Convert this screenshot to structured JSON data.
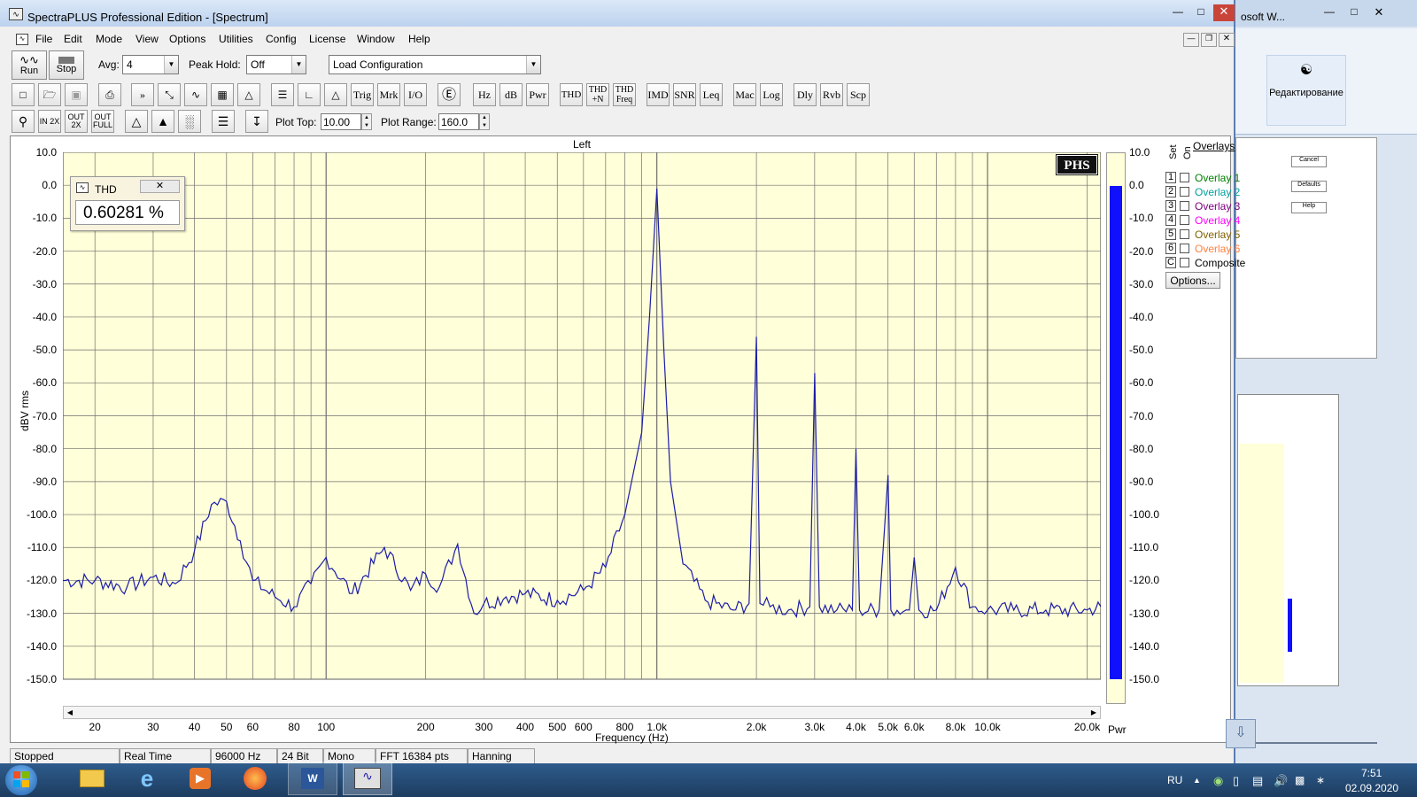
{
  "window": {
    "title": "SpectraPLUS Professional Edition - [Spectrum]"
  },
  "menu": [
    "File",
    "Edit",
    "Mode",
    "View",
    "Options",
    "Utilities",
    "Config",
    "License",
    "Window",
    "Help"
  ],
  "controls": {
    "run_label": "Run",
    "stop_label": "Stop",
    "avg_label": "Avg:",
    "avg_value": "4",
    "peak_hold_label": "Peak Hold:",
    "peak_hold_value": "Off",
    "load_config": "Load Configuration",
    "plot_top_label": "Plot Top:",
    "plot_top_value": "10.00",
    "plot_range_label": "Plot Range:",
    "plot_range_value": "160.0"
  },
  "toolbar": {
    "trig": "Trig",
    "mrk": "Mrk",
    "io": "I/O",
    "hz": "Hz",
    "db": "dB",
    "pwr": "Pwr",
    "thd": "THD",
    "thdn": "THD +N",
    "thdfreq": "THD Freq",
    "imd": "IMD",
    "snr": "SNR",
    "leq": "Leq",
    "mac": "Mac",
    "log": "Log",
    "dly": "Dly",
    "rvb": "Rvb",
    "scp": "Scp",
    "zoom_in": "IN 2X",
    "zoom_out": "OUT 2X",
    "zoom_full": "OUT FULL"
  },
  "thd_window": {
    "title": "THD",
    "value": "0.60281 %"
  },
  "plot": {
    "channel_title": "Left",
    "phs_logo": "PHS",
    "y_axis_label": "dBV rms",
    "x_axis_label": "Frequency (Hz)",
    "power_bar_label": "Pwr",
    "y_ticks": [
      "10.0",
      "0.0",
      "-10.0",
      "-20.0",
      "-30.0",
      "-40.0",
      "-50.0",
      "-60.0",
      "-70.0",
      "-80.0",
      "-90.0",
      "-100.0",
      "-110.0",
      "-120.0",
      "-130.0",
      "-140.0",
      "-150.0"
    ],
    "x_ticks": [
      "20",
      "30",
      "40",
      "50",
      "60",
      "80",
      "100",
      "200",
      "300",
      "400",
      "500",
      "600",
      "800",
      "1.0k",
      "2.0k",
      "3.0k",
      "4.0k",
      "5.0k",
      "6.0k",
      "8.0k",
      "10.0k",
      "20.0k"
    ],
    "power_level_db": -0.2,
    "colors": {
      "background": "#ffffd9",
      "trace": "#1c1ca8",
      "grid": "#6f6f6f",
      "power_bar": "#1010ff"
    }
  },
  "chart_data": {
    "type": "line",
    "title": "Left",
    "xlabel": "Frequency (Hz)",
    "ylabel": "dBV rms",
    "x_scale": "log",
    "xlim": [
      16,
      22000
    ],
    "ylim": [
      -150,
      10
    ],
    "grid": true,
    "series": [
      {
        "x": [
          16,
          20,
          25,
          30,
          35,
          40,
          45,
          50,
          55,
          60,
          70,
          80,
          90,
          100,
          120,
          150,
          180,
          200,
          220,
          250,
          280,
          300,
          350,
          400,
          500,
          600,
          700,
          800,
          900,
          950,
          1000,
          1050,
          1100,
          1200,
          1400,
          1700,
          1900,
          2000,
          2050,
          2200,
          2500,
          2900,
          3000,
          3100,
          3500,
          3900,
          4000,
          4100,
          4700,
          5000,
          5100,
          5800,
          6000,
          6200,
          7000,
          8000,
          9000,
          10000,
          12000,
          15000,
          20000,
          22000
        ],
        "y": [
          -120,
          -120,
          -122,
          -119,
          -121,
          -111,
          -97,
          -96,
          -108,
          -120,
          -125,
          -128,
          -121,
          -113,
          -124,
          -110,
          -123,
          -118,
          -122,
          -109,
          -130,
          -127,
          -125,
          -124,
          -126,
          -123,
          -116,
          -100,
          -75,
          -40,
          -1,
          -50,
          -90,
          -115,
          -126,
          -129,
          -127,
          -46,
          -127,
          -128,
          -129,
          -128,
          -57,
          -128,
          -129,
          -129,
          -80,
          -129,
          -129,
          -88,
          -129,
          -129,
          -113,
          -129,
          -129,
          -116,
          -128,
          -129,
          -129,
          -129,
          -129,
          -128
        ]
      }
    ]
  },
  "overlays": {
    "header": "Overlays",
    "set_label": "Set",
    "on_label": "On",
    "items": [
      {
        "num": "1",
        "label": "Overlay 1",
        "color": "#008000"
      },
      {
        "num": "2",
        "label": "Overlay 2",
        "color": "#00a0a0"
      },
      {
        "num": "3",
        "label": "Overlay 3",
        "color": "#800080"
      },
      {
        "num": "4",
        "label": "Overlay 4",
        "color": "#ff00ff"
      },
      {
        "num": "5",
        "label": "Overlay 5",
        "color": "#806000"
      },
      {
        "num": "6",
        "label": "Overlay 6",
        "color": "#ff8040"
      },
      {
        "num": "C",
        "label": "Composite",
        "color": "#000000"
      }
    ],
    "options_label": "Options..."
  },
  "status": [
    "Stopped",
    "Real Time",
    "96000 Hz",
    "24 Bit",
    "Mono",
    "FFT 16384 pts",
    "Hanning"
  ],
  "background_window": {
    "title": "osoft W...",
    "ribbon_label": "Редактирование",
    "buttons": [
      "Cancel",
      "Defaults",
      "Help"
    ]
  },
  "taskbar": {
    "language": "RU",
    "time": "7:51",
    "date": "02.09.2020"
  }
}
